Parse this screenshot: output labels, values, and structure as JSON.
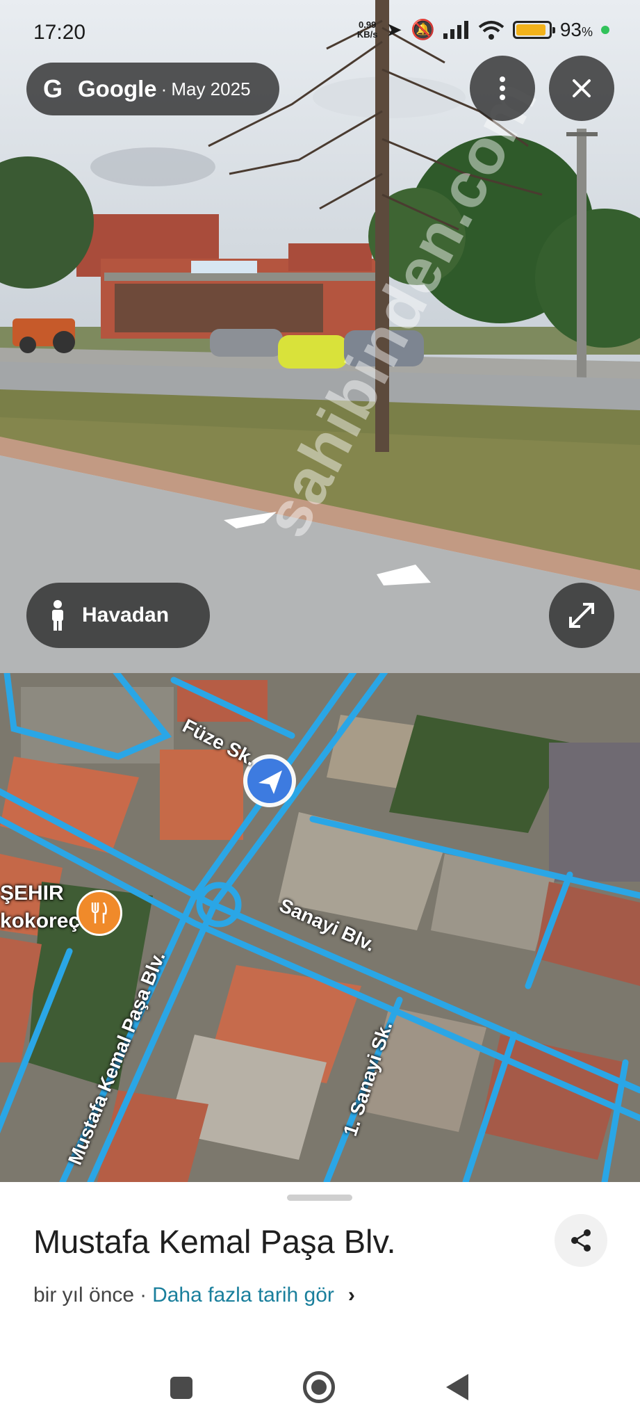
{
  "status_bar": {
    "time": "17:20",
    "net_speed_value": "0.99",
    "net_speed_unit": "KB/s",
    "battery_percent": "93",
    "battery_suffix": "%",
    "battery_level": 0.93,
    "icons": [
      "navigation-arrow-icon",
      "silent-icon",
      "signal-bars-icon",
      "wifi-icon",
      "battery-icon",
      "status-dot-icon"
    ]
  },
  "street_view": {
    "provider_letter": "G",
    "provider": "Google",
    "separator": "·",
    "capture_date": "May 2025",
    "more_icon": "more-vertical-icon",
    "close_icon": "close-icon",
    "view_mode_label": "Havadan",
    "view_mode_icon": "person-icon",
    "expand_icon": "expand-icon",
    "watermark": "sahibinden.com"
  },
  "map": {
    "street_labels": [
      "Füze Sk.",
      "Sanayi Blv.",
      "Mustafa Kemal Paşa Blv.",
      "1. Sanayi Sk."
    ],
    "poi_label_line1": "ŞEHIR",
    "poi_label_line2": "kokoreç",
    "poi_icon": "restaurant-icon",
    "location_icon": "navigation-arrow-icon",
    "colors": {
      "road_highlight": "#2aa6e6",
      "location": "#3d7be0",
      "poi": "#f08a2a"
    }
  },
  "info_sheet": {
    "title": "Mustafa Kemal Paşa Blv.",
    "relative_time": "bir yıl önce",
    "separator": "·",
    "more_dates_link": "Daha fazla tarih gör",
    "chevron": "›",
    "share_icon": "share-icon"
  },
  "nav_bar": {
    "icons": [
      "recents-square-icon",
      "home-circle-icon",
      "back-triangle-icon"
    ]
  }
}
